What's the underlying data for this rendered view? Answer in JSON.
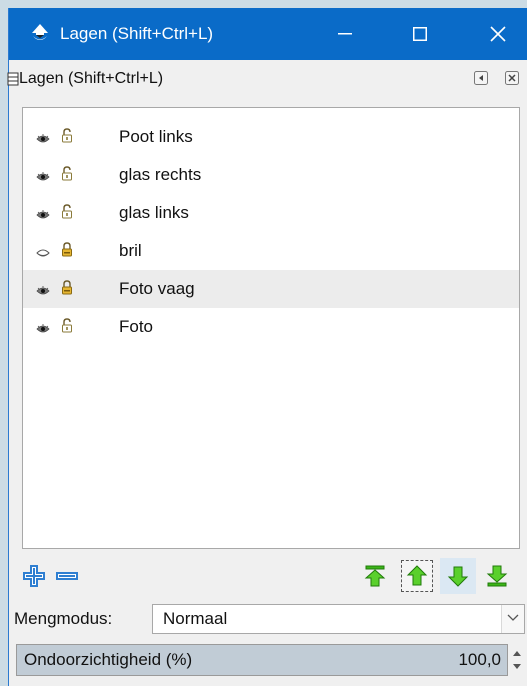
{
  "window": {
    "title": "Lagen (Shift+Ctrl+L)",
    "icon": "inkscape-icon",
    "controls": [
      "minimize-icon",
      "maximize-icon",
      "close-icon"
    ]
  },
  "panel": {
    "title": "Lagen (Shift+Ctrl+L)",
    "icons": [
      "panel-icon",
      "iconify-icon",
      "close-icon"
    ]
  },
  "layers": [
    {
      "name": "Poot links",
      "visible": true,
      "locked": false
    },
    {
      "name": "glas rechts",
      "visible": true,
      "locked": false
    },
    {
      "name": "glas links",
      "visible": true,
      "locked": false
    },
    {
      "name": "bril",
      "visible": false,
      "locked": true
    },
    {
      "name": "Foto vaag",
      "visible": true,
      "locked": true,
      "selected": true
    },
    {
      "name": "Foto",
      "visible": true,
      "locked": false
    }
  ],
  "toolbar": {
    "buttons": [
      "add-layer-icon",
      "remove-layer-icon",
      "raise-to-top-icon",
      "raise-layer-icon",
      "lower-layer-icon",
      "lower-to-bottom-icon"
    ]
  },
  "blend": {
    "label": "Mengmodus:",
    "value": "Normaal"
  },
  "opacity": {
    "label": "Ondoorzichtigheid (%)",
    "value": "100,0",
    "fill_fraction": 1.0
  },
  "colors": {
    "titlebar": "#0a6bc8",
    "arrow_green": "#3cb518",
    "add_blue": "#2f7fd1"
  }
}
